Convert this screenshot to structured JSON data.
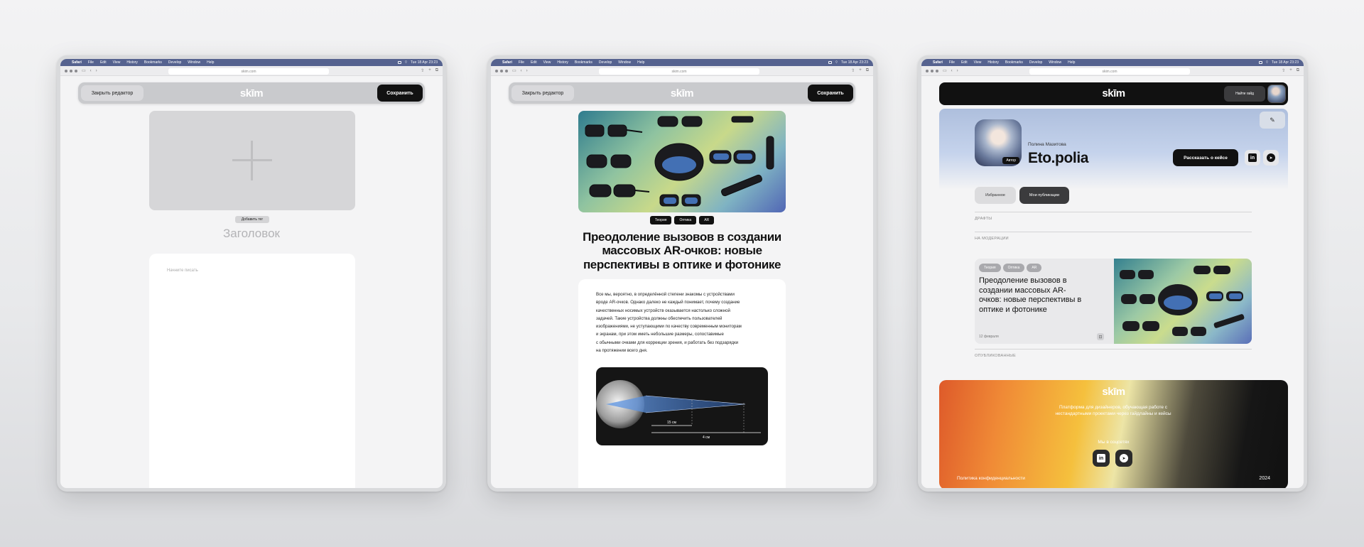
{
  "browser": {
    "menubar": {
      "apple": "",
      "app": "Safari",
      "items": [
        "File",
        "Edit",
        "View",
        "History",
        "Bookmarks",
        "Develop",
        "Window",
        "Help"
      ],
      "status": "Tue 18 Apr 23:23"
    },
    "url": "skim.com"
  },
  "logo": "skīm",
  "editor": {
    "close_label": "Закрыть редактор",
    "save_label": "Сохранить",
    "add_tag_label": "Добавить тег",
    "title_placeholder": "Заголовок",
    "body_placeholder": "Начните писать"
  },
  "article": {
    "tags": [
      "Теория",
      "Оптика",
      "AR"
    ],
    "title": "Преодоление вызовов в создании массовых AR-очков: новые перспективы в оптике и фотонике",
    "body_lines": [
      "Все мы, вероятно, в определённой степени знакомы с устройствами",
      "вроде AR-очков. Однако далеко не каждый понимает, почему создание",
      "качественных носимых устройств оказывается настолько сложной",
      "задачей. Такие устройства должны обеспечить пользователей",
      "изображениями, не уступающими по качеству современным мониторам",
      "и экранам, при этом иметь небольшие размеры, сопоставимые",
      "с обычными очками для коррекции зрения, и работать без подзарядки",
      "на протяжении всего дня."
    ],
    "diagram": {
      "label_short": "15 см",
      "label_long": "4 см"
    }
  },
  "profile": {
    "find_guide_label": "Найти гайд",
    "author_badge": "Автор",
    "name": "Полина Мазитова",
    "nickname": "Eto.polia",
    "tell_case_label": "Рассказать о кейсе",
    "tabs": [
      "Избранное",
      "Мои публикации"
    ],
    "sections": {
      "drafts": "ДРАФТЫ",
      "moderation": "НА МОДЕРАЦИИ",
      "published": "ОПУБЛИКОВАННЫЕ"
    },
    "card": {
      "tags": [
        "Теория",
        "Оптика",
        "AR"
      ],
      "title": "Преодоление вызовов в создании массовых AR-очков: новые перспективы в оптике и фотонике",
      "date": "12 февраля"
    }
  },
  "footer": {
    "desc": "Платформа для дизайнеров, обучающая работе с нестандартными проектами через гайдлайны и кейсы",
    "social_label": "Мы в соцсетях",
    "privacy": "Политика конфиденциальности",
    "year": "2024"
  },
  "colors": {
    "accent": "#111111",
    "menubar": "#55628f",
    "footer_orange": "#de5a2a",
    "footer_yellow": "#f5c03d"
  },
  "icons": [
    "plus-icon",
    "linkedin-icon",
    "telegram-icon",
    "pencil-icon",
    "bookmark-icon",
    "apple-icon",
    "wifi-icon",
    "battery-icon"
  ]
}
